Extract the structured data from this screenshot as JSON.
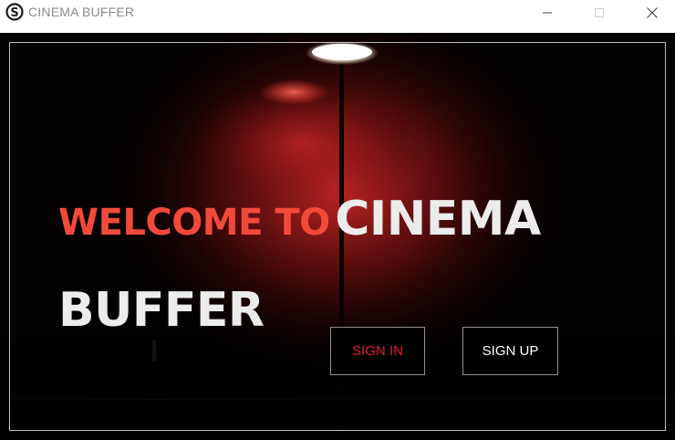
{
  "window": {
    "title": "CINEMA BUFFER",
    "icon": "cinema-buffer-logo-icon",
    "controls": [
      "minimize-icon",
      "maximize-icon",
      "close-icon"
    ]
  },
  "hero": {
    "headline_red": "WELCOME TO",
    "headline_white_1": "CINEMA",
    "headline_white_2": "BUFFER"
  },
  "actions": {
    "signin_label": "SIGN IN",
    "signup_label": "SIGN UP"
  },
  "colors": {
    "accent_red": "#f24a3a",
    "signin_text": "#e4202a",
    "background": "#020202",
    "headline_white": "#ececec"
  }
}
